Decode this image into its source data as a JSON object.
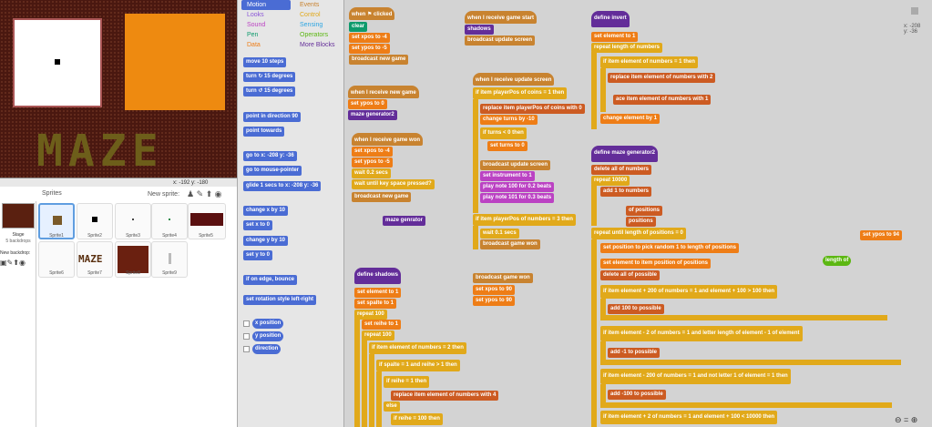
{
  "stage": {
    "title_text": "MAZE",
    "mouse": "x: -192  y: -180"
  },
  "sprites": {
    "header": "Sprites",
    "new_sprite": "New sprite:",
    "stage_label": "Stage",
    "stage_sub": "5 backdrops",
    "new_backdrop": "New backdrop:",
    "list": [
      "Sprite1",
      "Sprite2",
      "Sprite3",
      "Sprite4",
      "Sprite5",
      "Sprite6",
      "Sprite7",
      "Sprite8",
      "Sprite9"
    ]
  },
  "categories": [
    [
      "Motion",
      "Events"
    ],
    [
      "Looks",
      "Control"
    ],
    [
      "Sound",
      "Sensing"
    ],
    [
      "Pen",
      "Operators"
    ],
    [
      "Data",
      "More Blocks"
    ]
  ],
  "palette": [
    "move 10 steps",
    "turn ↻ 15 degrees",
    "turn ↺ 15 degrees",
    "point in direction 90",
    "point towards",
    "go to x: -208 y: -36",
    "go to mouse-pointer",
    "glide 1 secs to x: -208 y: -36",
    "change x by 10",
    "set x to 0",
    "change y by 10",
    "set y to 0",
    "if on edge, bounce",
    "set rotation style left-right",
    "x position",
    "y position",
    "direction"
  ],
  "script_coord": "x: -208\ny: -36",
  "blocks": {
    "s1": [
      "when ⚑ clicked",
      "clear",
      "set xpos to -4",
      "set ypos to -5",
      "broadcast new game"
    ],
    "s2": [
      "when I receive new game",
      "set ypos to 0",
      "maze generator2"
    ],
    "s3": [
      "when I receive game won",
      "set xpos to -4",
      "set ypos to -5",
      "wait 0.2 secs",
      "wait until key space pressed?",
      "broadcast new game"
    ],
    "s4": "maze genrator",
    "s5": [
      "define shadows",
      "set element to 1",
      "set spalte to 1",
      "repeat 100",
      "set reihe to 1",
      "repeat 100",
      "if item element of numbers = 2 then",
      "if spalte = 1 and reihe > 1 then",
      "if reihe = 1 then",
      "replace item element of numbers with 4",
      "else",
      "if reihe = 100 then"
    ],
    "s6": [
      "when I receive game start",
      "shadows",
      "broadcast update screen"
    ],
    "s7": [
      "when I receive update screen",
      "if item playerPos of coins = 1 then",
      "replace item playerPos of coins with 0",
      "change turns by -10",
      "if turns < 0 then",
      "set turns to 0",
      "broadcast update screen",
      "set instrument to 1",
      "play note 100 for 0.2 beats",
      "play note 101 for 0.3 beats",
      "if item playerPos of numbers = 3 then",
      "wait 0.1 secs",
      "broadcast game won"
    ],
    "s8": [
      "broadcast game won",
      "set xpos to 90",
      "set ypos to 90"
    ],
    "s9": [
      "define invert",
      "set element to 1",
      "repeat length of numbers",
      "if item element of numbers = 1 then",
      "replace item element of numbers with 2",
      "ace item element of numbers with 1",
      "change element by 1"
    ],
    "s10": [
      "define maze generator2",
      "delete all of numbers",
      "repeat 10000",
      "add 1 to numbers",
      "of positions",
      "positions",
      "repeat until length of positions = 0",
      "set position to pick random 1 to length of positions",
      "set element to item position of positions",
      "delete all of possible",
      "if item element + 200 of numbers = 1 and element + 100 > 100 then",
      "add 100 to possible",
      "if item element - 2 of numbers = 1 and letter length of element - 1 of element",
      "add -1 to possible",
      "if item element - 200 of numbers = 1 and not letter 1 of element = 1 then",
      "add -100 to possible",
      "if item element + 2 of numbers = 1 and element + 100 < 10000 then"
    ],
    "s11": "set ypos to 94",
    "s12": "length of"
  }
}
